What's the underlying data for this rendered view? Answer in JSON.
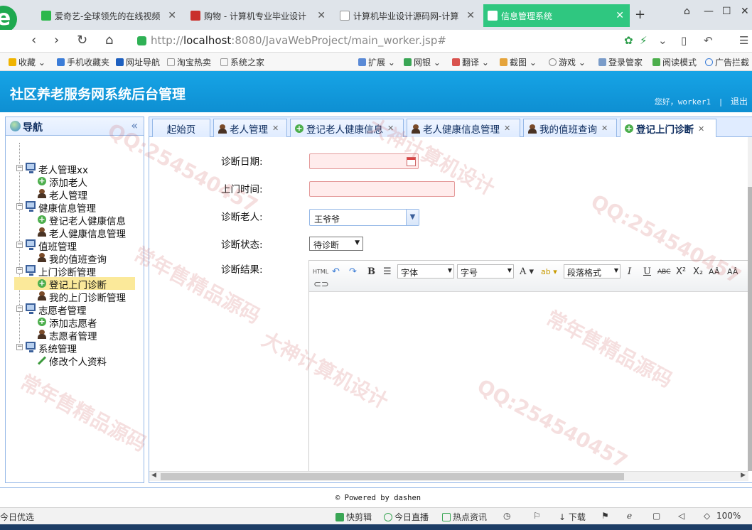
{
  "browser": {
    "tabs": [
      {
        "label": "爱奇艺-全球领先的在线视频",
        "icon_color": "#2cb84b"
      },
      {
        "label": "购物 - 计算机专业毕业设计",
        "icon_color": "#c9302c"
      },
      {
        "label": "计算机毕业设计源码网-计算",
        "icon_color": "#dddddd"
      },
      {
        "label": "信息管理系统",
        "icon_color": "#ffffff",
        "active": true
      }
    ],
    "url_prefix": "http://",
    "url_host": "localhost",
    "url_rest": ":8080/JavaWebProject/main_worker.jsp#",
    "bookmarks": [
      "收藏",
      "手机收藏夹",
      "网址导航",
      "淘宝热卖",
      "系统之家",
      "扩展",
      "网银",
      "翻译",
      "截图",
      "游戏",
      "登录管家",
      "阅读模式",
      "广告拦截"
    ]
  },
  "app": {
    "title": "社区养老服务网系统后台管理",
    "greeting": "您好，worker1",
    "separator": "|",
    "logout": "退出"
  },
  "nav": {
    "title": "导航",
    "tree": [
      {
        "label": "老人管理xx",
        "children": [
          "添加老人",
          "老人管理"
        ]
      },
      {
        "label": "健康信息管理",
        "children": [
          "登记老人健康信息",
          "老人健康信息管理"
        ]
      },
      {
        "label": "值班管理",
        "children": [
          "我的值班查询"
        ]
      },
      {
        "label": "上门诊断管理",
        "children": [
          "登记上门诊断",
          "我的上门诊断管理"
        ]
      },
      {
        "label": "志愿者管理",
        "children": [
          "添加志愿者",
          "志愿者管理"
        ]
      },
      {
        "label": "系统管理",
        "children": [
          "修改个人资料"
        ]
      }
    ],
    "selected": "登记上门诊断"
  },
  "tabs": [
    {
      "label": "起始页",
      "closable": false
    },
    {
      "label": "老人管理",
      "closable": true
    },
    {
      "label": "登记老人健康信息",
      "closable": true
    },
    {
      "label": "老人健康信息管理",
      "closable": true
    },
    {
      "label": "我的值班查询",
      "closable": true
    },
    {
      "label": "登记上门诊断",
      "closable": true,
      "active": true
    }
  ],
  "form": {
    "date_label": "诊断日期:",
    "date_value": "",
    "time_label": "上门时间:",
    "time_value": "",
    "elder_label": "诊断老人:",
    "elder_value": "王爷爷",
    "status_label": "诊断状态:",
    "status_value": "待诊断",
    "result_label": "诊断结果:"
  },
  "editor": {
    "html_btn": "HTML",
    "bold": "B",
    "font_family": "字体",
    "font_size": "字号",
    "text_color": "A",
    "paragraph": "段落格式",
    "italic": "I",
    "underline": "U",
    "strike": "ABC"
  },
  "footer": {
    "text": "Powered by dashen"
  },
  "statusbar": {
    "left": "今日优选",
    "items": [
      "快剪辑",
      "今日直播",
      "热点资讯",
      "下载"
    ],
    "zoom": "100%"
  },
  "watermarks": [
    "常年售精品源码",
    "大神计算机设计",
    "QQ:254540457"
  ]
}
